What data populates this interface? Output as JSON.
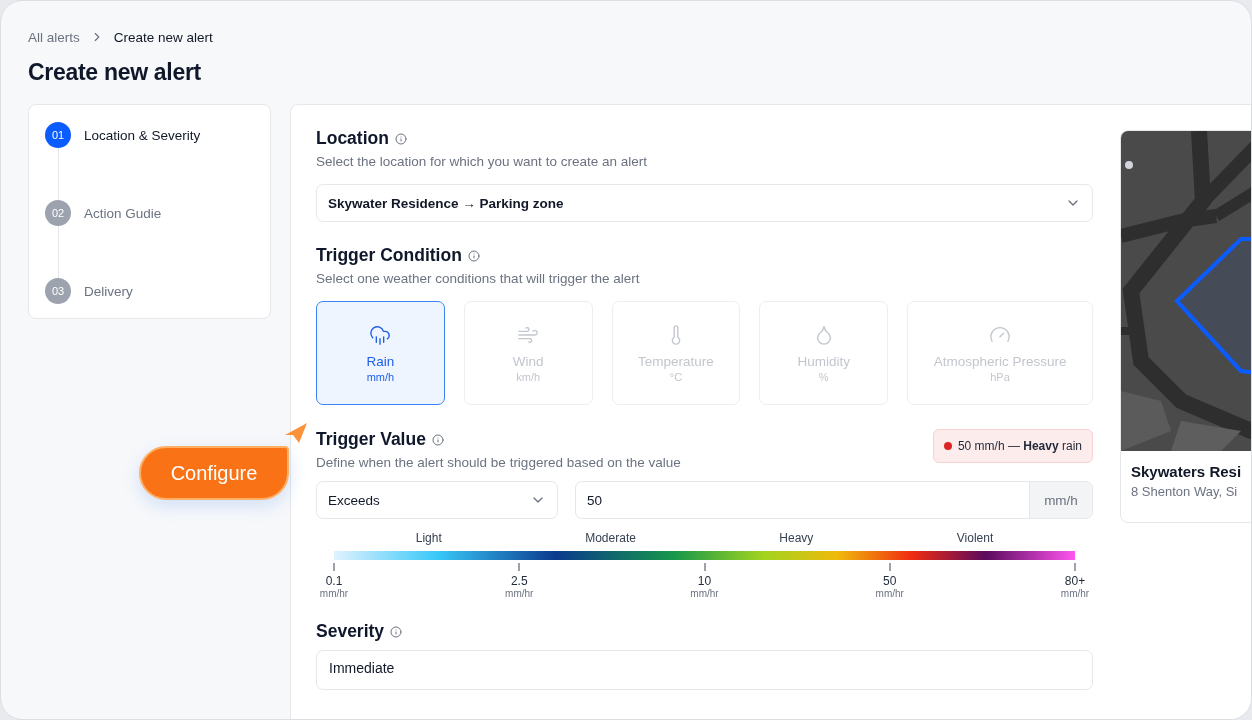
{
  "breadcrumb": [
    {
      "label": "All alerts",
      "current": false
    },
    {
      "label": "Create new alert",
      "current": true
    }
  ],
  "title": "Create new alert",
  "steps": [
    {
      "number": "01",
      "label": "Location & Severity",
      "selected": true
    },
    {
      "number": "02",
      "label": "Action Gudie",
      "selected": false
    },
    {
      "number": "03",
      "label": "Delivery",
      "selected": false
    }
  ],
  "callout": {
    "label": "Configure"
  },
  "location": {
    "title": "Location",
    "subtitle": "Select the location for which you want to create an alert",
    "value": "Skywater Residence → Parking zone"
  },
  "trigger_condition": {
    "title": "Trigger Condition",
    "subtitle": "Select one weather conditions that will trigger the alert",
    "options": [
      {
        "kind": "rain",
        "label": "Rain",
        "unit": "mm/h",
        "selected": true
      },
      {
        "kind": "wind",
        "label": "Wind",
        "unit": "km/h",
        "selected": false
      },
      {
        "kind": "temperature",
        "label": "Temperature",
        "unit": "°C",
        "selected": false
      },
      {
        "kind": "humidity",
        "label": "Humidity",
        "unit": "%",
        "selected": false
      },
      {
        "kind": "pressure",
        "label": "Atmospheric Pressure",
        "unit": "hPa",
        "selected": false
      }
    ]
  },
  "trigger_value": {
    "title": "Trigger Value",
    "subtitle": "Define when the alert should be triggered based on the value",
    "badge": {
      "text": "50 mm/h — **Heavy** rain",
      "color": "#dc2626"
    },
    "operator": "Exceeds",
    "value": "50",
    "unit": "mm/h",
    "scale_labels": [
      "Light",
      "Moderate",
      "Heavy",
      "Violent"
    ],
    "scale_ticks": [
      {
        "value": "0.1",
        "unit": "mm/hr"
      },
      {
        "value": "2.5",
        "unit": "mm/hr"
      },
      {
        "value": "10",
        "unit": "mm/hr"
      },
      {
        "value": "50",
        "unit": "mm/hr"
      },
      {
        "value": "80+",
        "unit": "mm/hr"
      }
    ]
  },
  "severity": {
    "title": "Severity",
    "value": "Immediate"
  },
  "map_card": {
    "kind": "picture",
    "name": "Skywaters Resi",
    "address": "8 Shenton Way, Si"
  }
}
